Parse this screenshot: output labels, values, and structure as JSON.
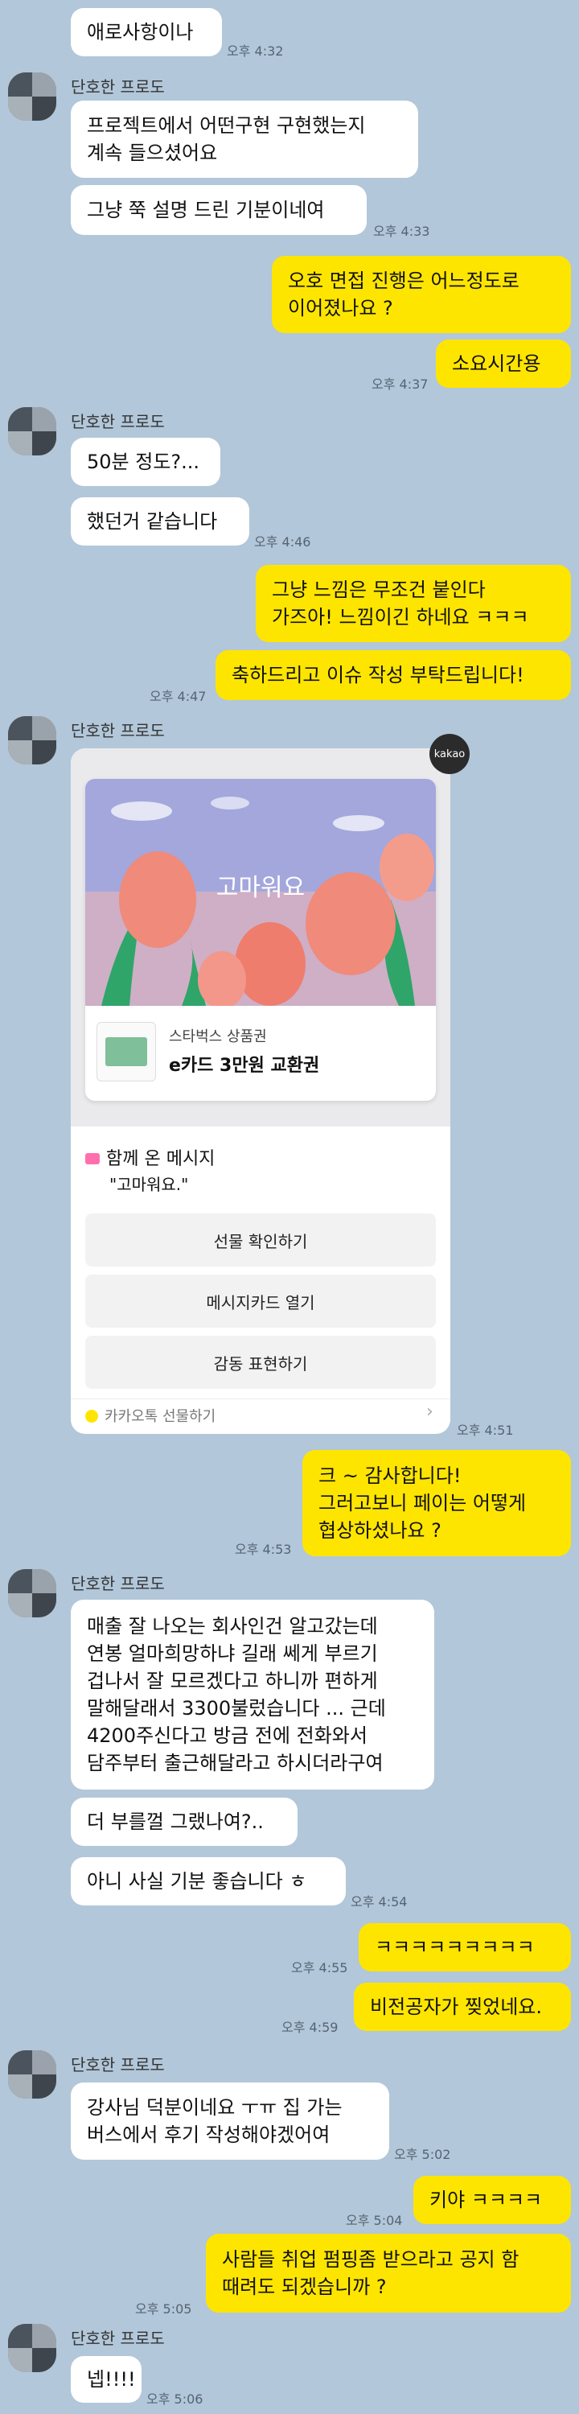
{
  "contact": {
    "name": "단호한 프로도"
  },
  "messages": {
    "m1": {
      "text": "애로사항이나"
    },
    "t1": "오후 4:32",
    "m2": {
      "text": "프로젝트에서 어떤구현 구현했는지\n계속 들으셨어요"
    },
    "m3": {
      "text": "그냥 쭉 설명 드린 기분이네여"
    },
    "t3": "오후 4:33",
    "m4": {
      "text": "오호 면접 진행은 어느정도로\n이어졌나요 ?"
    },
    "m5": {
      "text": "소요시간용"
    },
    "t5": "오후 4:37",
    "m6": {
      "text": "50분 정도?..."
    },
    "m7": {
      "text": "했던거 같습니다"
    },
    "t7": "오후 4:46",
    "m8": {
      "text": "그냥 느낌은 무조건 붙인다\n가즈아! 느낌이긴 하네요 ㅋㅋㅋ"
    },
    "m9": {
      "text": "축하드리고 이슈 작성 부탁드립니다!"
    },
    "t9": "오후 4:47",
    "t_gift": "오후 4:51",
    "m10": {
      "text": "크 ~ 감사합니다!\n그러고보니 페이는 어떻게\n협상하셨나요 ?"
    },
    "t10": "오후 4:53",
    "m11": {
      "text": "매출 잘 나오는 회사인건 알고갔는데\n연봉 얼마희망하냐 길래 쎄게 부르기\n겁나서 잘 모르겠다고 하니까 편하게\n말해달래서 3300불렀습니다 ... 근데\n4200주신다고 방금 전에 전화와서\n담주부터 출근해달라고 하시더라구여"
    },
    "m12": {
      "text": "더 부를껄 그랬나여?.."
    },
    "m13": {
      "text": "아니 사실 기분 좋습니다 ㅎ"
    },
    "t13": "오후 4:54",
    "m14": {
      "text": "ㅋㅋㅋㅋㅋㅋㅋㅋㅋ"
    },
    "t14": "오후 4:55",
    "m15": {
      "text": "비전공자가 찢었네요."
    },
    "t15": "오후 4:59",
    "m16": {
      "text": "강사님 덕분이네요 ㅜㅠ 집 가는\n버스에서 후기 작성해야겠어여"
    },
    "t16": "오후 5:02",
    "m17": {
      "text": "키야 ㅋㅋㅋㅋ"
    },
    "t17": "오후 5:04",
    "m18": {
      "text": "사람들 취업 펌핑좀 받으라고 공지 함\n때려도 되겠습니까 ?"
    },
    "t18": "오후 5:05",
    "m19": {
      "text": "넵!!!!"
    },
    "t19": "오후 5:06"
  },
  "gift": {
    "kakao_badge": "kakao",
    "banner_text": "고마워요",
    "brand": "스타벅스 상품권",
    "product": "e카드 3만원 교환권",
    "message_title": "함께 온 메시지",
    "message_body": "\"고마워요.\"",
    "btn_check": "선물 확인하기",
    "btn_card": "메시지카드 열기",
    "btn_react": "감동 표현하기",
    "footer": "카카오톡 선물하기",
    "colors": {
      "sky": "#9fa6d8",
      "tulip": "#f08a7a",
      "leaf": "#2fa56a"
    }
  }
}
